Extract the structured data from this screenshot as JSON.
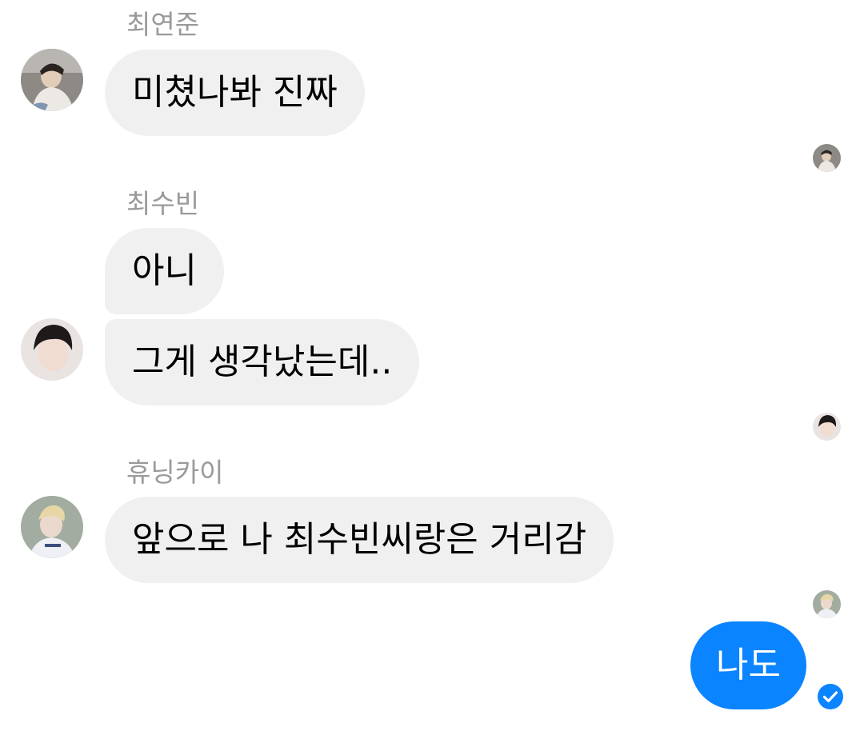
{
  "messages": [
    {
      "sender": "최연준",
      "text": "미쳤나봐 진짜"
    },
    {
      "sender": "최수빈",
      "texts": [
        "아니",
        "그게 생각났는데.."
      ]
    },
    {
      "sender": "휴닝카이",
      "text": "앞으로 나 최수빈씨랑은 거리감"
    }
  ],
  "outgoing": {
    "text": "나도",
    "color": "#0a84ff"
  },
  "colors": {
    "incoming_bubble": "#f0f0f0",
    "sender_name": "#9a9a9a",
    "accent": "#0a84ff"
  },
  "icons": {
    "delivered": "check-circle-icon"
  }
}
